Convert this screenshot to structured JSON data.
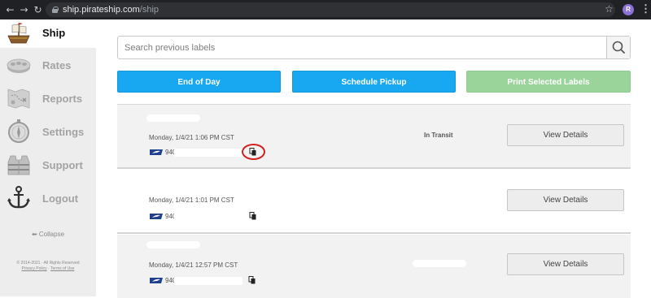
{
  "browser": {
    "url_domain": "ship.pirateship.com",
    "url_path": "/ship",
    "profile_initial": "R"
  },
  "sidebar": {
    "items": [
      {
        "label": "Ship",
        "icon": "pirate-ship-icon",
        "active": true
      },
      {
        "label": "Rates",
        "icon": "coins-icon",
        "active": false
      },
      {
        "label": "Reports",
        "icon": "treasure-map-icon",
        "active": false
      },
      {
        "label": "Settings",
        "icon": "compass-icon",
        "active": false
      },
      {
        "label": "Support",
        "icon": "life-vest-icon",
        "active": false
      },
      {
        "label": "Logout",
        "icon": "anchor-icon",
        "active": false
      }
    ],
    "collapse_label": "⬅ Collapse",
    "copyright": "© 2014-2021 · All Rights Reserved",
    "privacy_link": "Privacy Policy",
    "link_sep": " · ",
    "terms_link": "Terms of Use"
  },
  "search": {
    "placeholder": "Search previous labels",
    "button_icon": "search-icon"
  },
  "actions": {
    "end_of_day": "End of Day",
    "schedule_pickup": "Schedule Pickup",
    "print_selected": "Print Selected Labels"
  },
  "shipments": [
    {
      "date": "Monday, 1/4/21 1:06 PM CST",
      "tracking": "940",
      "status": "In Transit",
      "view": "View Details",
      "carrier_icon": "usps-eagle-icon"
    },
    {
      "date": "Monday, 1/4/21 1:01 PM CST",
      "tracking": "940",
      "status": "",
      "view": "View Details",
      "carrier_icon": "usps-eagle-icon"
    },
    {
      "date": "Monday, 1/4/21 12:57 PM CST",
      "tracking": "940",
      "status": "",
      "view": "View Details",
      "carrier_icon": "usps-eagle-icon"
    }
  ],
  "colors": {
    "primary_blue": "#18a8f1",
    "disabled_green": "#9bd49b",
    "highlight_red": "#d32020"
  }
}
